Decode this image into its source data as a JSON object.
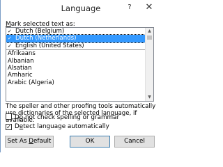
{
  "window": {
    "title": "Language",
    "help_label": "?",
    "close_label": "✕"
  },
  "mark_label": "Mark selected text as:",
  "languages": [
    {
      "name": "Dutch (Belgium)",
      "spell": true,
      "selected": false
    },
    {
      "name": "Dutch (Netherlands)",
      "spell": true,
      "selected": true
    },
    {
      "name": "English (United States)",
      "spell": true,
      "selected": false
    },
    {
      "name": "Afrikaans",
      "spell": false,
      "selected": false
    },
    {
      "name": "Albanian",
      "spell": false,
      "selected": false
    },
    {
      "name": "Alsatian",
      "spell": false,
      "selected": false
    },
    {
      "name": "Amharic",
      "spell": false,
      "selected": false
    },
    {
      "name": "Arabic (Algeria)",
      "spell": false,
      "selected": false
    }
  ],
  "info_text": "The speller and other proofing tools automatically use dictionaries of the selected language, if available.",
  "checkboxes": {
    "no_spell": {
      "label": "Do not check spelling or grammar",
      "checked": false
    },
    "detect": {
      "label": "Detect language automatically",
      "checked": true
    }
  },
  "buttons": {
    "default_label": "Set As Default",
    "ok_label": "OK",
    "cancel_label": "Cancel"
  },
  "colors": {
    "selection": "#3399ff",
    "ok_border": "#3c7fb1"
  }
}
